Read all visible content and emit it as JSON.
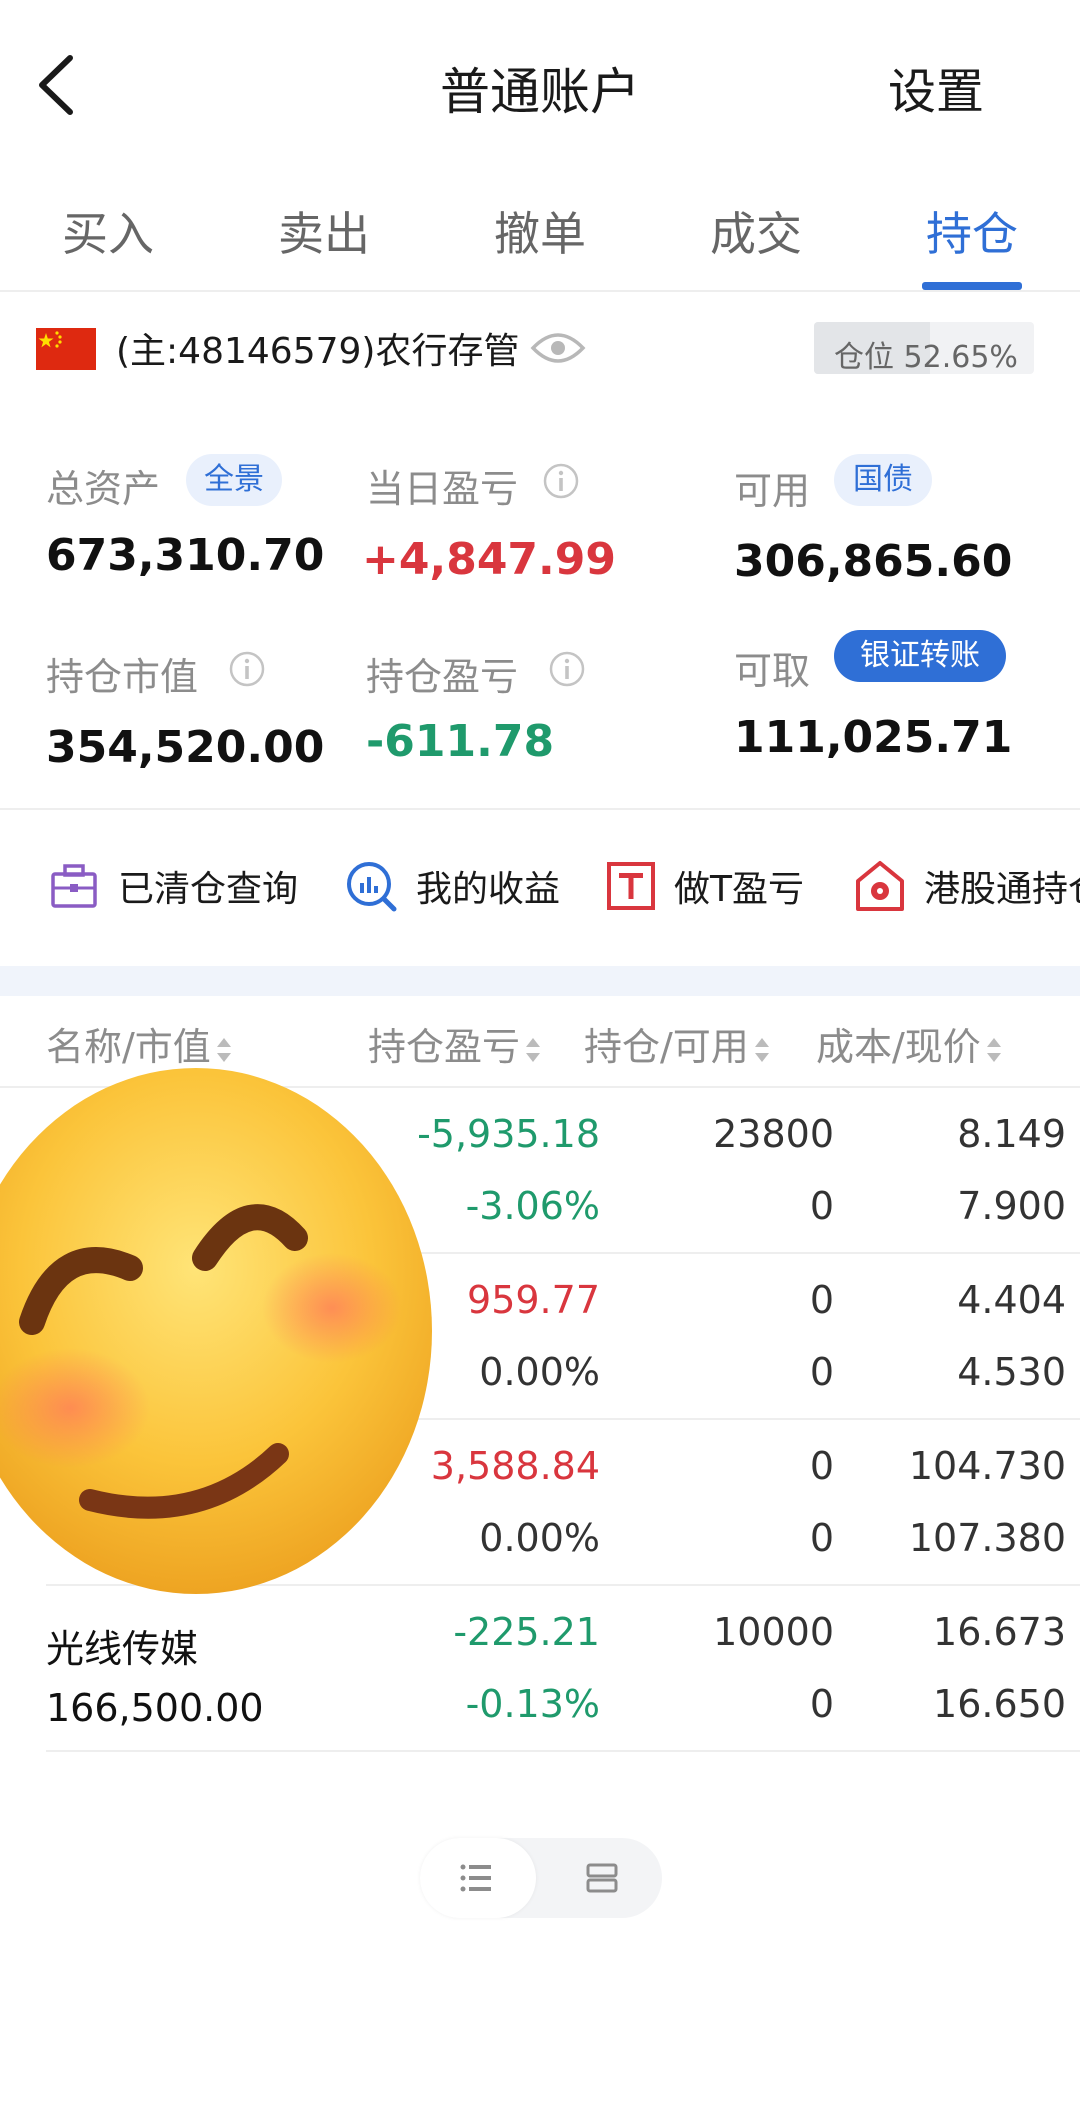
{
  "header": {
    "title": "普通账户",
    "settings_label": "设置"
  },
  "tabs": [
    {
      "label": "买入"
    },
    {
      "label": "卖出"
    },
    {
      "label": "撤单"
    },
    {
      "label": "成交"
    },
    {
      "label": "持仓",
      "active": true
    }
  ],
  "account": {
    "label": "(主:48146579)农行存管",
    "position_label": "仓位 52.65%",
    "position_ratio": 0.5265
  },
  "metrics": {
    "total_assets": {
      "label": "总资产",
      "tag": "全景",
      "value": "673,310.70"
    },
    "daily_pnl": {
      "label": "当日盈亏",
      "value": "+4,847.99"
    },
    "available": {
      "label": "可用",
      "tag": "国债",
      "value": "306,865.60"
    },
    "market_value": {
      "label": "持仓市值",
      "value": "354,520.00"
    },
    "position_pnl": {
      "label": "持仓盈亏",
      "value": "-611.78"
    },
    "withdrawable": {
      "label": "可取",
      "tag": "银证转账",
      "value": "111,025.71"
    }
  },
  "quick_actions": [
    {
      "label": "已清仓查询",
      "icon": "briefcase-icon"
    },
    {
      "label": "我的收益",
      "icon": "chart-search-icon"
    },
    {
      "label": "做T盈亏",
      "icon": "t-box-icon"
    },
    {
      "label": "港股通持仓",
      "icon": "hk-house-icon"
    }
  ],
  "table": {
    "headers": [
      "名称/市值",
      "持仓盈亏",
      "持仓/可用",
      "成本/现价"
    ],
    "rows": [
      {
        "name": "",
        "market_value": "",
        "pnl": "-5,935.18",
        "pnl_pct": "-3.06%",
        "hold": "23800",
        "avail": "0",
        "cost": "8.149",
        "price": "7.900",
        "tone": "green"
      },
      {
        "name": "",
        "market_value": "",
        "pnl": "959.77",
        "pnl_pct": "0.00%",
        "hold": "0",
        "avail": "0",
        "cost": "4.404",
        "price": "4.530",
        "tone": "red"
      },
      {
        "name": "",
        "market_value": "",
        "pnl": "3,588.84",
        "pnl_pct": "0.00%",
        "hold": "0",
        "avail": "0",
        "cost": "104.730",
        "price": "107.380",
        "tone": "red"
      },
      {
        "name": "光线传媒",
        "market_value": "166,500.00",
        "pnl": "-225.21",
        "pnl_pct": "-0.13%",
        "hold": "10000",
        "avail": "0",
        "cost": "16.673",
        "price": "16.650",
        "tone": "green"
      }
    ]
  },
  "colors": {
    "accent": "#2f6fd6",
    "up": "#d9363e",
    "down": "#1f9a6c"
  }
}
